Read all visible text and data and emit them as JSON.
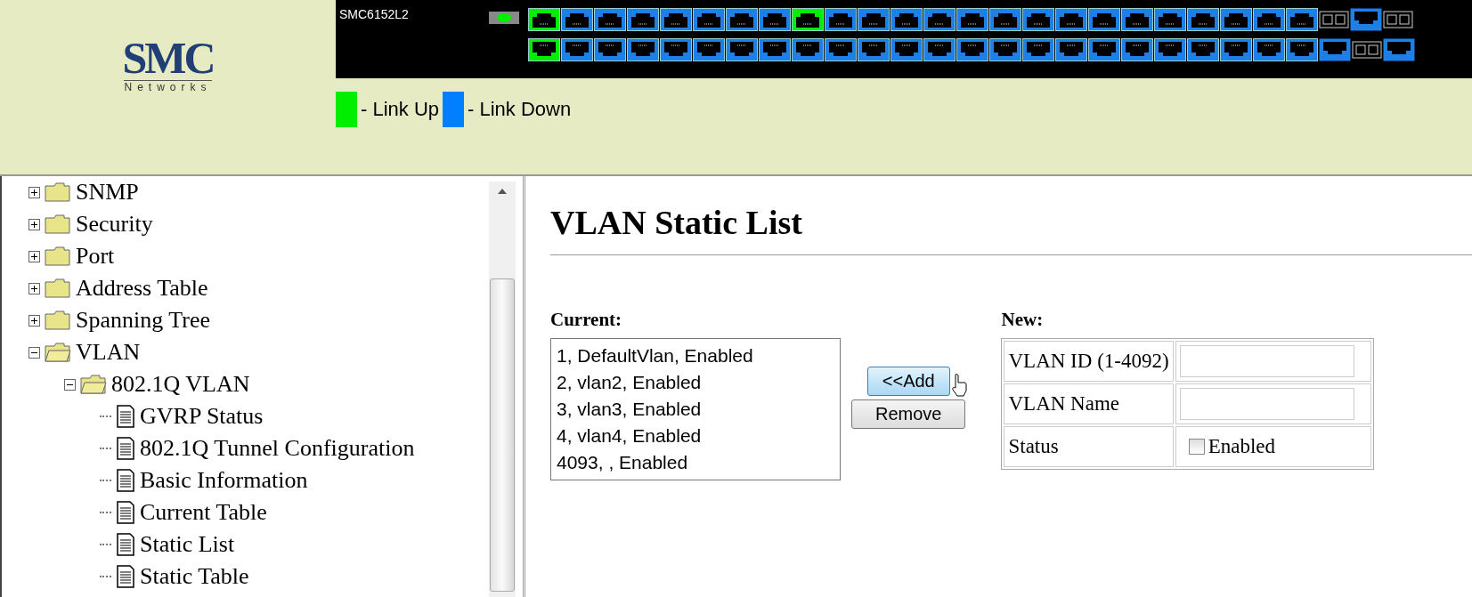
{
  "header": {
    "logo": {
      "brand": "SMC",
      "tagline": "Networks"
    },
    "model": "SMC6152L2",
    "ports_top": [
      {
        "up": true
      },
      {
        "up": false
      },
      {
        "up": false
      },
      {
        "up": false
      },
      {
        "up": false
      },
      {
        "up": false
      },
      {
        "up": false
      },
      {
        "up": false
      },
      {
        "up": true
      },
      {
        "up": false
      },
      {
        "up": false
      },
      {
        "up": false
      },
      {
        "up": false
      },
      {
        "up": false
      },
      {
        "up": false
      },
      {
        "up": false
      },
      {
        "up": false
      },
      {
        "up": false
      },
      {
        "up": false
      },
      {
        "up": false
      },
      {
        "up": false
      },
      {
        "up": false
      },
      {
        "up": false
      },
      {
        "up": false
      }
    ],
    "ports_bottom": [
      {
        "up": true
      },
      {
        "up": false
      },
      {
        "up": false
      },
      {
        "up": false
      },
      {
        "up": false
      },
      {
        "up": false
      },
      {
        "up": false
      },
      {
        "up": false
      },
      {
        "up": false
      },
      {
        "up": false
      },
      {
        "up": false
      },
      {
        "up": false
      },
      {
        "up": false
      },
      {
        "up": false
      },
      {
        "up": false
      },
      {
        "up": false
      },
      {
        "up": false
      },
      {
        "up": false
      },
      {
        "up": false
      },
      {
        "up": false
      },
      {
        "up": false
      },
      {
        "up": false
      },
      {
        "up": false
      },
      {
        "up": false
      }
    ],
    "legend": [
      {
        "label": "- Link Up",
        "color": "#00ee00"
      },
      {
        "label": "- Link Down",
        "color": "#0080ff"
      }
    ]
  },
  "tree": [
    {
      "label": "SNMP",
      "kind": "folder",
      "expanded": false
    },
    {
      "label": "Security",
      "kind": "folder",
      "expanded": false
    },
    {
      "label": "Port",
      "kind": "folder",
      "expanded": false
    },
    {
      "label": "Address Table",
      "kind": "folder",
      "expanded": false
    },
    {
      "label": "Spanning Tree",
      "kind": "folder",
      "expanded": false
    },
    {
      "label": "VLAN",
      "kind": "folder",
      "expanded": true,
      "children": [
        {
          "label": "802.1Q VLAN",
          "kind": "folder",
          "expanded": true,
          "children": [
            {
              "label": "GVRP Status",
              "kind": "page"
            },
            {
              "label": "802.1Q Tunnel Configuration",
              "kind": "page"
            },
            {
              "label": "Basic Information",
              "kind": "page"
            },
            {
              "label": "Current Table",
              "kind": "page"
            },
            {
              "label": "Static List",
              "kind": "page"
            },
            {
              "label": "Static Table",
              "kind": "page"
            }
          ]
        }
      ]
    }
  ],
  "page": {
    "title": "VLAN Static List",
    "current": {
      "label": "Current:",
      "items": [
        "1, DefaultVlan, Enabled",
        "2, vlan2, Enabled",
        "3, vlan3, Enabled",
        "4, vlan4, Enabled",
        "4093, , Enabled"
      ]
    },
    "buttons": [
      "<<Add",
      "Remove"
    ],
    "new": {
      "label": "New:",
      "fields": [
        {
          "label": "VLAN ID (1-4092)",
          "kind": "text"
        },
        {
          "label": "VLAN Name",
          "kind": "text"
        },
        {
          "label": "Status",
          "kind": "checkbox",
          "option": "Enabled",
          "checked": false
        }
      ]
    }
  }
}
